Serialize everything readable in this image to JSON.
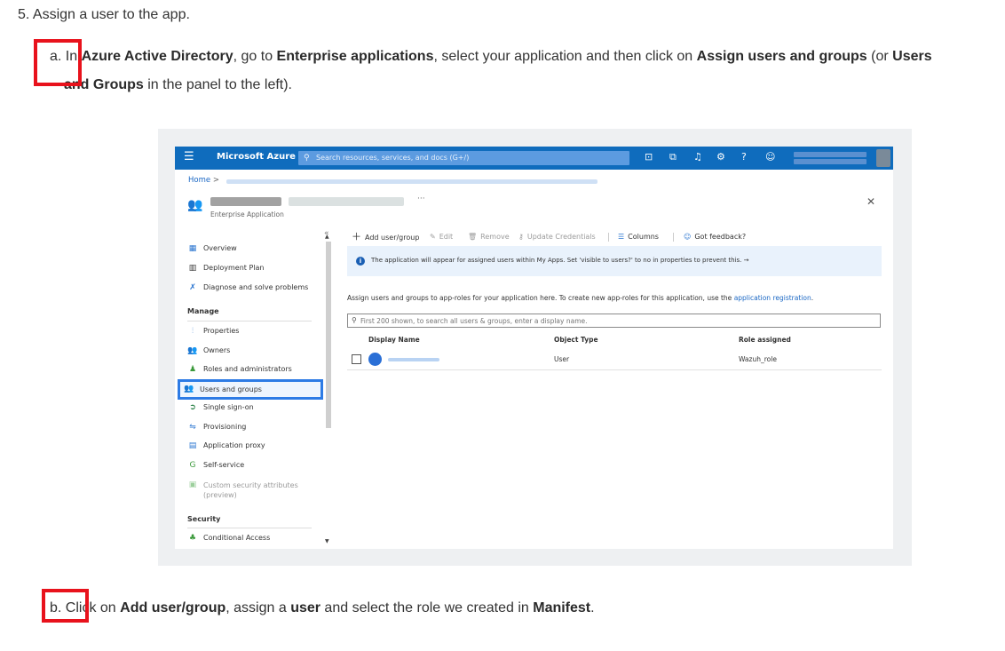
{
  "doc": {
    "step5": "5. Assign a user to the app.",
    "step_a": {
      "prefix": "a. In ",
      "azure_ad": "Azure Active Directory",
      "t1": ", go to ",
      "enterprise_apps": "Enterprise applications",
      "t2": ", select your application and then click on ",
      "assign": "Assign users and groups",
      "t3": " (or ",
      "users_word": "Users",
      "line2_bold": "and Groups",
      "line2_rest": " in the panel to the left)."
    },
    "step_b": {
      "prefix": "b. Click on ",
      "add": "Add user/group",
      "t1": ", assign a ",
      "user": "user",
      "t2": " and select the role we created in ",
      "manifest": "Manifest",
      "t3": "."
    }
  },
  "portal": {
    "brand": "Microsoft Azure",
    "search_placeholder": "Search resources, services, and docs (G+/)",
    "breadcrumb_home": "Home",
    "breadcrumb_sep": ">",
    "subtitle": "Enterprise Application",
    "more": "···",
    "close": "✕",
    "sidebar": {
      "items": [
        {
          "label": "Overview",
          "icon": "grid-icon"
        },
        {
          "label": "Deployment Plan",
          "icon": "book-icon"
        },
        {
          "label": "Diagnose and solve problems",
          "icon": "wrench-icon"
        }
      ],
      "manage_heading": "Manage",
      "manage_items": [
        {
          "label": "Properties",
          "icon": "properties-icon"
        },
        {
          "label": "Owners",
          "icon": "owners-icon"
        },
        {
          "label": "Roles and administrators",
          "icon": "roles-icon"
        },
        {
          "label": "Users and groups",
          "icon": "users-icon"
        },
        {
          "label": "Single sign-on",
          "icon": "sso-icon"
        },
        {
          "label": "Provisioning",
          "icon": "provisioning-icon"
        },
        {
          "label": "Application proxy",
          "icon": "proxy-icon"
        },
        {
          "label": "Self-service",
          "icon": "self-service-icon"
        },
        {
          "label": "Custom security attributes (preview)",
          "icon": "attributes-icon"
        }
      ],
      "security_heading": "Security",
      "security_items": [
        {
          "label": "Conditional Access",
          "icon": "conditional-access-icon"
        }
      ]
    },
    "toolbar": {
      "add": "Add user/group",
      "edit": "Edit",
      "remove": "Remove",
      "update": "Update Credentials",
      "columns": "Columns",
      "feedback": "Got feedback?"
    },
    "info": "The application will appear for assigned users within My Apps. Set 'visible to users?' to no in properties to prevent this.  →",
    "assign_text": "Assign users and groups to app-roles for your application here. To create new app-roles for this application, use the ",
    "assign_link": "application registration",
    "assign_end": ".",
    "table_search_placeholder": "First 200 shown, to search all users & groups, enter a display name.",
    "columns": {
      "display_name": "Display Name",
      "object_type": "Object Type",
      "role": "Role assigned"
    },
    "rows": [
      {
        "object_type": "User",
        "role": "Wazuh_role"
      }
    ]
  },
  "colors": {
    "accent": "#0f6cbd",
    "highlight": "#e8121c",
    "selection": "#2d7be5"
  }
}
